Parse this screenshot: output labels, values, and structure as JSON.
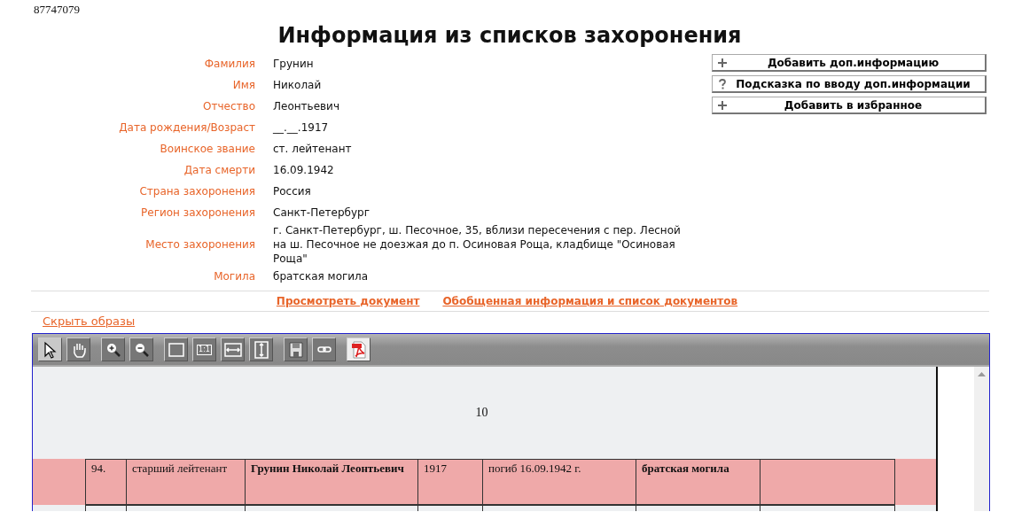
{
  "record_id": "87747079",
  "title": "Информация из списков захоронения",
  "fields": [
    {
      "label": "Фамилия",
      "value": "Грунин"
    },
    {
      "label": "Имя",
      "value": "Николай"
    },
    {
      "label": "Отчество",
      "value": "Леонтьевич"
    },
    {
      "label": "Дата рождения/Возраст",
      "value": "__.__.1917"
    },
    {
      "label": "Воинское звание",
      "value": "ст. лейтенант"
    },
    {
      "label": "Дата смерти",
      "value": "16.09.1942"
    },
    {
      "label": "Страна захоронения",
      "value": "Россия"
    },
    {
      "label": "Регион захоронения",
      "value": "Санкт-Петербург"
    },
    {
      "label": "Место захоронения",
      "value": "г. Санкт-Петербург, ш. Песочное, 35, вблизи пересечения с пер. Лесной на ш. Песочное не доезжая до п. Осиновая Роща, кладбище \"Осиновая Роща\""
    },
    {
      "label": "Могила",
      "value": "братская могила"
    }
  ],
  "actions": [
    {
      "kind": "plus",
      "label": "Добавить доп.информацию"
    },
    {
      "kind": "question",
      "label": "Подсказка по вводу доп.информации"
    },
    {
      "kind": "plus",
      "label": "Добавить в избранное"
    }
  ],
  "links": [
    "Просмотреть документ",
    "Обобщенная информация и список документов"
  ],
  "hide_images_link": "Скрыть образы",
  "viewer": {
    "toolbar": [
      [
        {
          "kind": "pointer",
          "selected": true
        },
        {
          "kind": "hand",
          "selected": false
        }
      ],
      [
        {
          "kind": "zoom-in",
          "selected": false
        },
        {
          "kind": "zoom-out",
          "selected": false
        }
      ],
      [
        {
          "kind": "fit-page",
          "selected": false
        },
        {
          "kind": "actual-size",
          "label": "1:1",
          "selected": false
        },
        {
          "kind": "fit-width",
          "selected": false
        },
        {
          "kind": "fit-height",
          "selected": false
        }
      ],
      [
        {
          "kind": "save",
          "selected": false
        },
        {
          "kind": "link",
          "selected": false
        }
      ],
      [
        {
          "kind": "pdf",
          "selected": false
        }
      ]
    ],
    "document": {
      "page_number": "10",
      "rows": [
        {
          "highlighted": true,
          "cells": [
            {
              "text": "94.",
              "bold": false
            },
            {
              "text": "старший лейтенант",
              "bold": false
            },
            {
              "text": "Грунин Николай Леонтьевич",
              "bold": true
            },
            {
              "text": "1917",
              "bold": false
            },
            {
              "text": "погиб 16.09.1942 г.",
              "bold": false
            },
            {
              "text": "братская могила",
              "bold": true
            }
          ]
        },
        {
          "highlighted": false
        }
      ]
    }
  }
}
